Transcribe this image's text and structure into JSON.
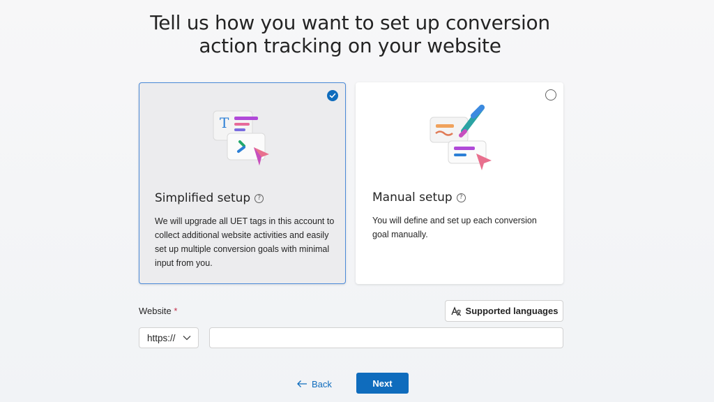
{
  "page": {
    "title_line1": "Tell us how you want to set up conversion",
    "title_line2": "action tracking on your website"
  },
  "options": [
    {
      "title": "Simplified setup",
      "description": "We will upgrade all UET tags in this account to collect additional website activities and easily set up multiple conversion goals with minimal input from you.",
      "selected": true
    },
    {
      "title": "Manual setup",
      "description": "You will define and set up each conversion goal manually.",
      "selected": false
    }
  ],
  "website": {
    "label": "Website",
    "required_marker": "*",
    "protocol": "https://",
    "url_value": "",
    "supported_languages_label": "Supported languages"
  },
  "nav": {
    "back_label": "Back",
    "next_label": "Next"
  },
  "colors": {
    "accent": "#0f6cbd",
    "selected_border": "#4a89d8",
    "required": "#c4314b"
  },
  "icons": [
    "checkmark-icon",
    "help-icon",
    "translate-icon",
    "chevron-down-icon",
    "arrow-left-icon"
  ]
}
